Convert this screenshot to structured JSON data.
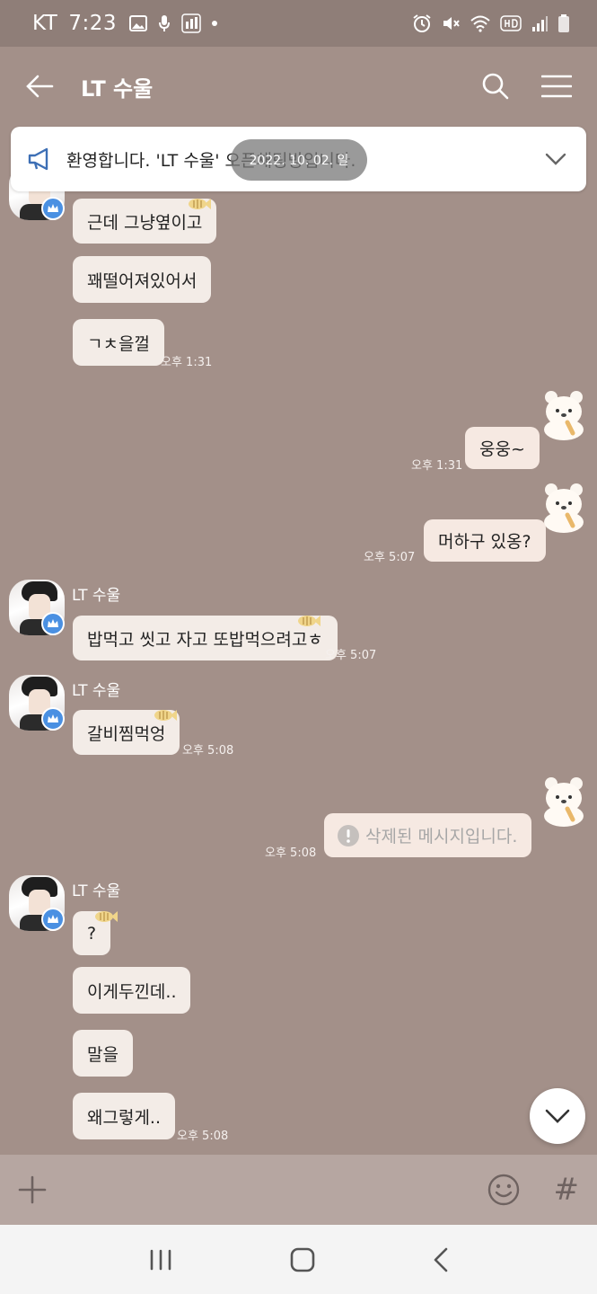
{
  "status_bar": {
    "carrier": "KT",
    "time": "7:23"
  },
  "header": {
    "title": "LT 수울"
  },
  "notice": {
    "text": "환영합니다. 'LT 수울' 오픈채팅방입니다."
  },
  "date_pill": "2022. 10. 02. 일",
  "messages": [
    {
      "sender": "",
      "text": "근데 그냥옆이고",
      "time": ""
    },
    {
      "sender": "",
      "text": "꽤떨어져있어서",
      "time": ""
    },
    {
      "sender": "",
      "text": "ㄱㅊ을껄",
      "time": "오후 1:31"
    },
    {
      "sender": "me",
      "text": "웅웅~",
      "time": "오후 1:31"
    },
    {
      "sender": "me",
      "text": "머하구 있옹?",
      "time": "오후 5:07"
    },
    {
      "sender": "LT 수울",
      "text": "밥먹고 씻고 자고 또밥먹으려고ㅎ",
      "time": "오후 5:07"
    },
    {
      "sender": "LT 수울",
      "text": "갈비찜먹엉",
      "time": "오후 5:08"
    },
    {
      "sender": "me",
      "text": "삭제된 메시지입니다.",
      "time": "오후 5:08"
    },
    {
      "sender": "LT 수울",
      "text": "?",
      "time": ""
    },
    {
      "sender": "",
      "text": "이게두낀데..",
      "time": ""
    },
    {
      "sender": "",
      "text": "말을",
      "time": ""
    },
    {
      "sender": "",
      "text": "왜그렇게..",
      "time": "오후 5:08"
    }
  ],
  "input_bar": {
    "hash_label": "#"
  },
  "colors": {
    "background": "#a39089",
    "bubble": "#f3ece7",
    "status_bar": "#8f7e78"
  }
}
